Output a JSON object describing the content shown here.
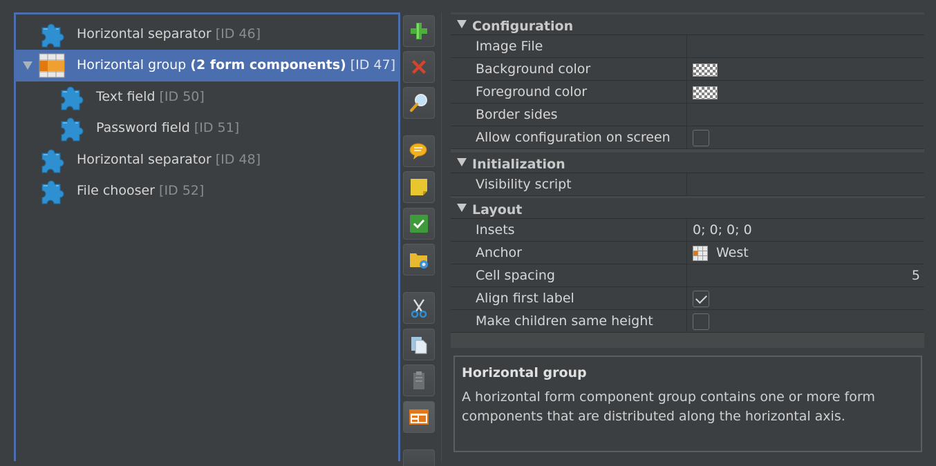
{
  "tree": {
    "items": [
      {
        "name": "Horizontal separator",
        "extra": "",
        "id_label": "[ID 46]",
        "selected": false,
        "level": 0
      },
      {
        "name": "Horizontal group",
        "extra": "(2 form components)",
        "id_label": "[ID 47]",
        "selected": true,
        "level": 0
      },
      {
        "name": "Text field",
        "extra": "",
        "id_label": "[ID 50]",
        "selected": false,
        "level": 1
      },
      {
        "name": "Password field",
        "extra": "",
        "id_label": "[ID 51]",
        "selected": false,
        "level": 1
      },
      {
        "name": "Horizontal separator",
        "extra": "",
        "id_label": "[ID 48]",
        "selected": false,
        "level": 0
      },
      {
        "name": "File chooser",
        "extra": "",
        "id_label": "[ID 52]",
        "selected": false,
        "level": 0
      }
    ]
  },
  "toolbar": {
    "buttons": [
      "add-icon",
      "delete-icon",
      "search-icon",
      "comment-icon",
      "note-icon",
      "check-icon",
      "folder-settings-icon",
      "cut-icon",
      "copy-icon",
      "paste-icon",
      "form-layout-icon"
    ]
  },
  "properties": {
    "categories": [
      {
        "label": "Configuration",
        "rows": [
          {
            "name": "Image File",
            "value": ""
          },
          {
            "name": "Background color",
            "value": ""
          },
          {
            "name": "Foreground color",
            "value": ""
          },
          {
            "name": "Border sides",
            "value": ""
          },
          {
            "name": "Allow configuration on screen",
            "value": ""
          }
        ]
      },
      {
        "label": "Initialization",
        "rows": [
          {
            "name": "Visibility script",
            "value": ""
          }
        ]
      },
      {
        "label": "Layout",
        "rows": [
          {
            "name": "Insets",
            "value": "0; 0; 0; 0"
          },
          {
            "name": "Anchor",
            "value": "West"
          },
          {
            "name": "Cell spacing",
            "value": "5"
          },
          {
            "name": "Align first label",
            "value": ""
          },
          {
            "name": "Make children same height",
            "value": ""
          }
        ]
      }
    ],
    "checkboxes": {
      "allow_configuration_on_screen": false,
      "align_first_label": true,
      "make_children_same_height": false
    }
  },
  "description": {
    "title": "Horizontal group",
    "text": "A horizontal form component group contains one or more form components that are distributed along the horizontal axis."
  },
  "colors": {
    "selection": "#4b6eaf",
    "background": "#3c3f41",
    "puzzle_icon": "#2e8fd1"
  }
}
